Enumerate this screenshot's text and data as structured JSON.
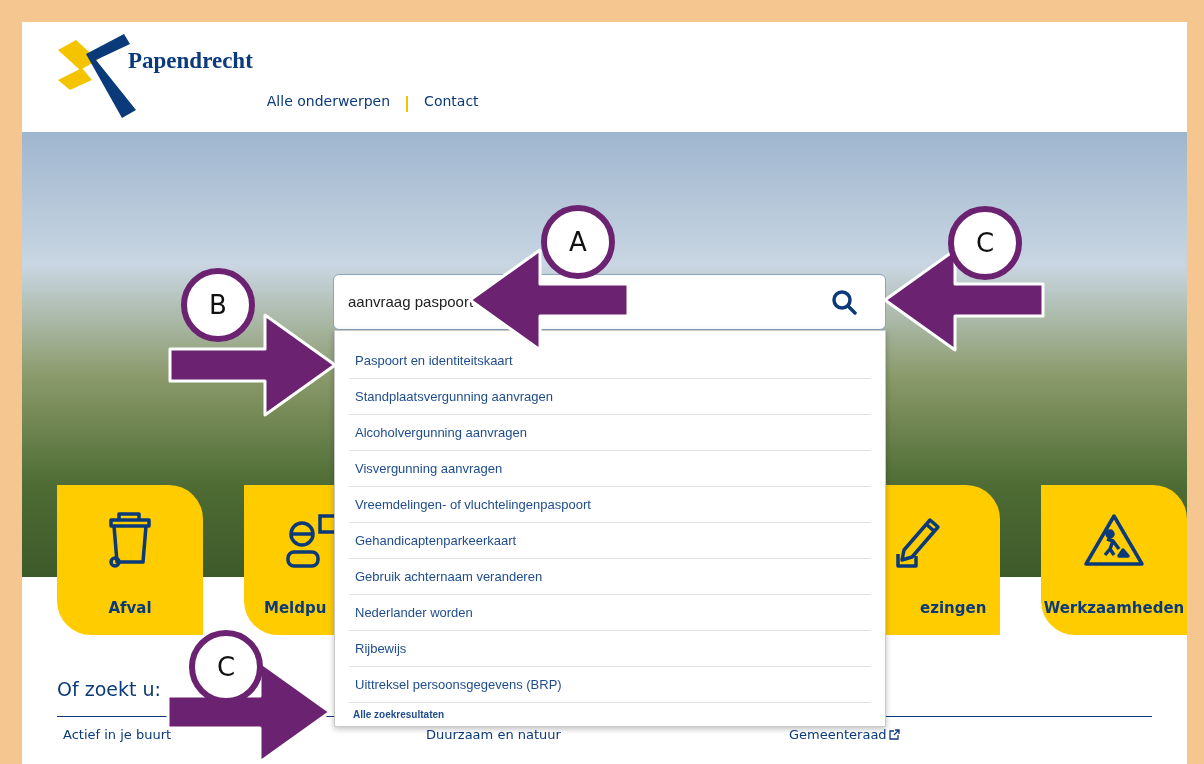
{
  "header": {
    "logo_text": "Papendrecht",
    "nav": [
      {
        "label": "Alle onderwerpen"
      },
      {
        "label": "Contact"
      }
    ]
  },
  "search": {
    "value": "aanvraag paspoort"
  },
  "suggestions": [
    {
      "label": "Paspoort en identiteitskaart"
    },
    {
      "label": "Standplaatsvergunning aanvragen"
    },
    {
      "label": "Alcoholvergunning aanvragen"
    },
    {
      "label": "Visvergunning aanvragen"
    },
    {
      "label": "Vreemdelingen- of vluchtelingenpaspoort"
    },
    {
      "label": "Gehandicaptenparkeerkaart"
    },
    {
      "label": "Gebruik achternaam veranderen"
    },
    {
      "label": "Nederlander worden"
    },
    {
      "label": "Rijbewijs"
    },
    {
      "label": "Uittreksel persoonsgegevens (BRP)"
    }
  ],
  "all_results_link": "Alle zoekresultaten",
  "tiles": [
    {
      "label": "Afval",
      "kind": "bin"
    },
    {
      "label": "Meldpu",
      "kind": "person"
    },
    {
      "label": "ezingen",
      "kind": "pencil"
    },
    {
      "label": "Werkzaamheden",
      "kind": "roadwork"
    }
  ],
  "section": {
    "title": "Of zoekt u:",
    "links": [
      {
        "label": "Actief in je buurt",
        "external": false
      },
      {
        "label": "Duurzaam en natuur",
        "external": false
      },
      {
        "label": "Gemeenteraad",
        "external": true
      }
    ]
  },
  "annotations": [
    {
      "letter": "A"
    },
    {
      "letter": "B"
    },
    {
      "letter": "C"
    },
    {
      "letter": "C"
    }
  ]
}
